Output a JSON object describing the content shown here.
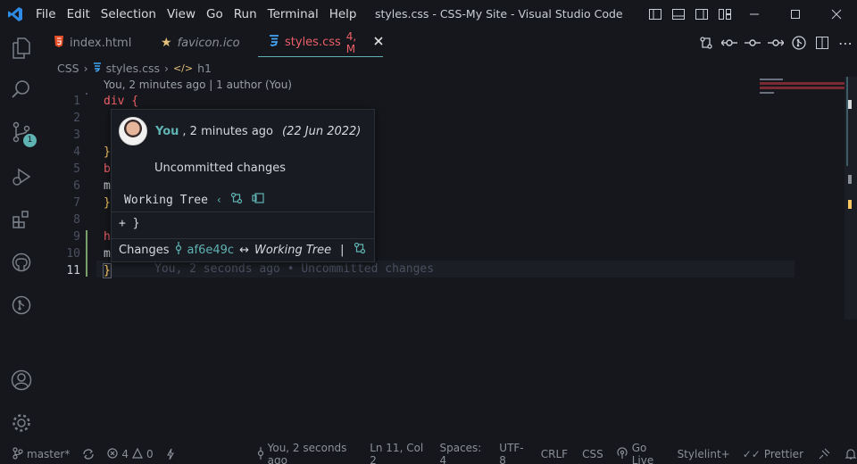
{
  "window": {
    "title": "styles.css - CSS-My Site - Visual Studio Code"
  },
  "menu": [
    "File",
    "Edit",
    "Selection",
    "View",
    "Go",
    "Run",
    "Terminal",
    "Help"
  ],
  "tabs": [
    {
      "label": "index.html",
      "icon": "html5-icon",
      "active": false
    },
    {
      "label": "favicon.ico",
      "icon": "star-icon",
      "active": false
    },
    {
      "label": "styles.css",
      "badge": "4, M",
      "icon": "css3-icon",
      "active": true
    }
  ],
  "breadcrumb": {
    "folder": "CSS",
    "file": "styles.css",
    "symbol": "h1"
  },
  "editor": {
    "blame_lens": "You, 2 minutes ago | 1 author (You)",
    "line_numbers": [
      "1",
      "2",
      "3",
      "4",
      "5",
      "6",
      "7",
      "8",
      "9",
      "10",
      "11"
    ],
    "lines": [
      "div {",
      "",
      "",
      "}",
      "b",
      "m",
      "}",
      "",
      "h",
      "m",
      "}"
    ],
    "current_line": "11",
    "ghost_blame": "You, 2 seconds ago • Uncommitted changes"
  },
  "hover": {
    "author": "You",
    "time": ", 2 minutes ago",
    "date": "(22 Jun 2022)",
    "message": "Uncommitted changes",
    "working_tree": "Working Tree",
    "diff_line": "+ }",
    "changes_label": "Changes",
    "commit": "af6e49c",
    "arrow": "↔",
    "target": "Working Tree",
    "separator": "|"
  },
  "statusbar": {
    "branch": "master*",
    "errors": "4",
    "warnings": "0",
    "blame": "You, 2 seconds ago",
    "position": "Ln 11, Col 2",
    "spaces": "Spaces: 4",
    "encoding": "UTF-8",
    "eol": "CRLF",
    "language": "CSS",
    "golive": "Go Live",
    "stylelint": "Stylelint+",
    "prettier": "Prettier"
  },
  "colors": {
    "accent": "#5fb3b3",
    "keyword": "#ec5f67",
    "brace": "#fac863",
    "tab_modified": "#ec5f67",
    "background": "#15171c"
  }
}
